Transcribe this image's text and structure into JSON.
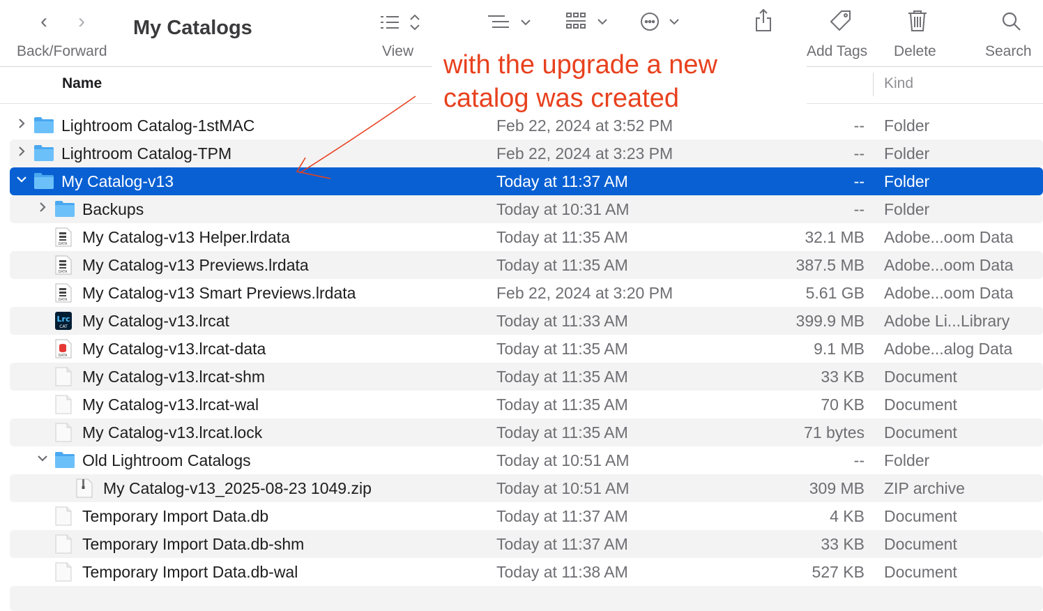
{
  "toolbar": {
    "back_forward_label": "Back/Forward",
    "title": "My Catalogs",
    "view_label": "View",
    "add_tags_label": "Add Tags",
    "delete_label": "Delete",
    "search_label": "Search"
  },
  "header": {
    "name": "Name",
    "kind": "Kind"
  },
  "annotation": {
    "line1": "with the upgrade a new",
    "line2": "catalog was created",
    "color": "#e8411e"
  },
  "selection_color": "#0860d3",
  "rows": [
    {
      "name": "Lightroom Catalog-1stMAC",
      "date": "Feb 22, 2024 at 3:52 PM",
      "size": "--",
      "kind": "Folder",
      "icon": "folder-icon",
      "disclosure": "collapsed"
    },
    {
      "name": "Lightroom Catalog-TPM",
      "date": "Feb 22, 2024 at 3:23 PM",
      "size": "--",
      "kind": "Folder",
      "icon": "folder-icon",
      "disclosure": "collapsed"
    },
    {
      "name": "My Catalog-v13",
      "date": "Today at 11:37 AM",
      "size": "--",
      "kind": "Folder",
      "icon": "folder-icon",
      "disclosure": "expanded",
      "selected": true
    },
    {
      "name": "Backups",
      "date": "Today at 10:31 AM",
      "size": "--",
      "kind": "Folder",
      "icon": "folder-icon",
      "disclosure": "collapsed"
    },
    {
      "name": "My Catalog-v13 Helper.lrdata",
      "date": "Today at 11:35 AM",
      "size": "32.1 MB",
      "kind": "Adobe...oom Data",
      "icon": "lrdata-file-icon"
    },
    {
      "name": "My Catalog-v13 Previews.lrdata",
      "date": "Today at 11:35 AM",
      "size": "387.5 MB",
      "kind": "Adobe...oom Data",
      "icon": "lrdata-file-icon"
    },
    {
      "name": "My Catalog-v13 Smart Previews.lrdata",
      "date": "Feb 22, 2024 at 3:20 PM",
      "size": "5.61 GB",
      "kind": "Adobe...oom Data",
      "icon": "lrdata-file-icon"
    },
    {
      "name": "My Catalog-v13.lrcat",
      "date": "Today at 11:33 AM",
      "size": "399.9 MB",
      "kind": "Adobe Li...Library",
      "icon": "lrcat-file-icon"
    },
    {
      "name": "My Catalog-v13.lrcat-data",
      "date": "Today at 11:35 AM",
      "size": "9.1 MB",
      "kind": "Adobe...alog Data",
      "icon": "lrcat-data-file-icon"
    },
    {
      "name": "My Catalog-v13.lrcat-shm",
      "date": "Today at 11:35 AM",
      "size": "33 KB",
      "kind": "Document",
      "icon": "document-icon"
    },
    {
      "name": "My Catalog-v13.lrcat-wal",
      "date": "Today at 11:35 AM",
      "size": "70 KB",
      "kind": "Document",
      "icon": "document-icon"
    },
    {
      "name": "My Catalog-v13.lrcat.lock",
      "date": "Today at 11:35 AM",
      "size": "71 bytes",
      "kind": "Document",
      "icon": "document-icon"
    },
    {
      "name": "Old Lightroom Catalogs",
      "date": "Today at 10:51 AM",
      "size": "--",
      "kind": "Folder",
      "icon": "folder-icon",
      "disclosure": "expanded"
    },
    {
      "name": "My Catalog-v13_2025-08-23 1049.zip",
      "date": "Today at 10:51 AM",
      "size": "309 MB",
      "kind": "ZIP archive",
      "icon": "zip-archive-icon"
    },
    {
      "name": "Temporary Import Data.db",
      "date": "Today at 11:37 AM",
      "size": "4 KB",
      "kind": "Document",
      "icon": "document-icon"
    },
    {
      "name": "Temporary Import Data.db-shm",
      "date": "Today at 11:37 AM",
      "size": "33 KB",
      "kind": "Document",
      "icon": "document-icon"
    },
    {
      "name": "Temporary Import Data.db-wal",
      "date": "Today at 11:38 AM",
      "size": "527 KB",
      "kind": "Document",
      "icon": "document-icon"
    }
  ]
}
